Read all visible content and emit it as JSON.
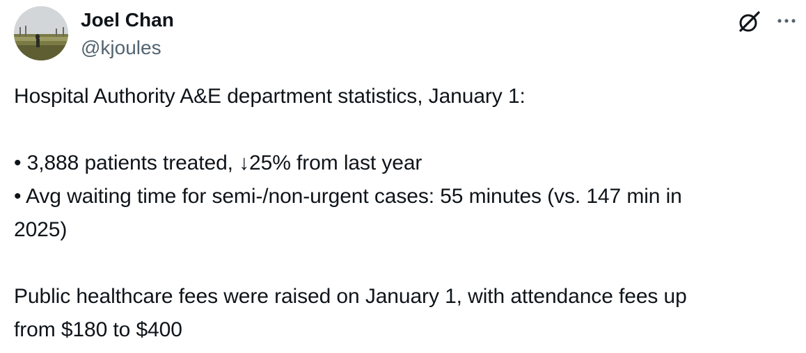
{
  "author": {
    "display_name": "Joel Chan",
    "handle": "@kjoules"
  },
  "icons": {
    "grok": "grok-icon",
    "more": "more-options-icon"
  },
  "tweet": {
    "line1": "Hospital Authority A&E department statistics, January 1:",
    "bullet1": "• 3,888 patients treated, ↓25% from last year",
    "bullet2_a": "• Avg waiting time for semi-/non-urgent cases: 55 minutes (vs. 147 min in",
    "bullet2_b": "2025)",
    "para2_a": "Public healthcare fees were raised on January 1, with attendance fees up",
    "para2_b": "from $180 to $400"
  }
}
